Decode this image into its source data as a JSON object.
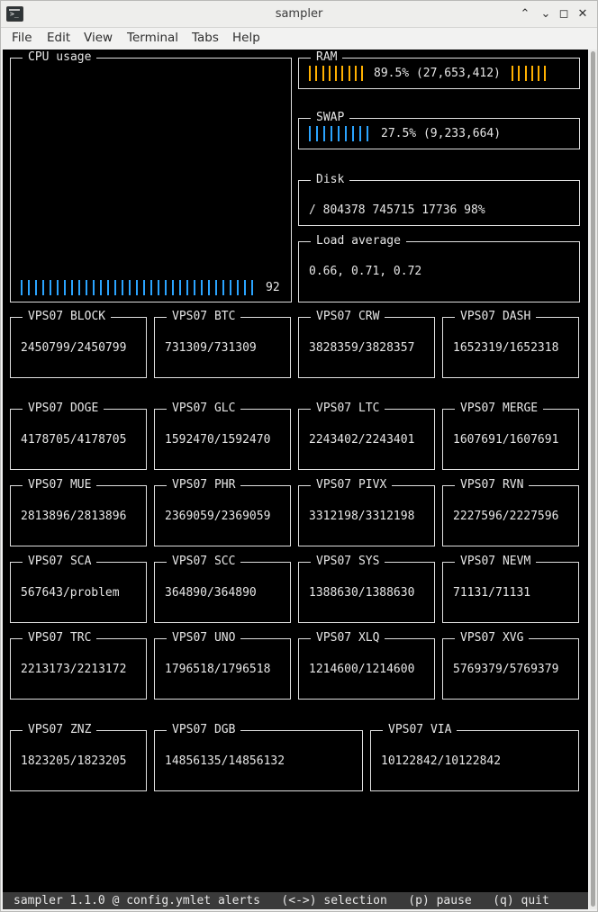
{
  "window": {
    "title": "sampler",
    "icon": "terminal-icon",
    "controls": {
      "minimize": "⌃",
      "restore": "⌄",
      "maximize": "◻",
      "close": "✕"
    }
  },
  "menubar": [
    "File",
    "Edit",
    "View",
    "Terminal",
    "Tabs",
    "Help"
  ],
  "cpu": {
    "title": "CPU usage",
    "value": "92",
    "level_percent": 92,
    "color": "#2aa4ff"
  },
  "ram": {
    "title": "RAM",
    "text": "89.5% (27,653,412)",
    "percent": 89.5,
    "color": "#ffb000"
  },
  "swap": {
    "title": "SWAP",
    "text": "27.5% (9,233,664)",
    "percent": 27.5,
    "color": "#2aa4ff"
  },
  "disk": {
    "title": "Disk",
    "text": "/ 804378 745715 17736 98%"
  },
  "load": {
    "title": "Load average",
    "text": "0.66, 0.71, 0.72"
  },
  "nodes": [
    {
      "title": "VPS07 BLOCK",
      "value": "2450799/2450799"
    },
    {
      "title": "VPS07 BTC",
      "value": "731309/731309"
    },
    {
      "title": "VPS07 CRW",
      "value": "3828359/3828357"
    },
    {
      "title": "VPS07 DASH",
      "value": "1652319/1652318"
    },
    {
      "title": "VPS07 DOGE",
      "value": "4178705/4178705"
    },
    {
      "title": "VPS07 GLC",
      "value": "1592470/1592470"
    },
    {
      "title": "VPS07 LTC",
      "value": "2243402/2243401"
    },
    {
      "title": "VPS07 MERGE",
      "value": "1607691/1607691"
    },
    {
      "title": "VPS07 MUE",
      "value": "2813896/2813896"
    },
    {
      "title": "VPS07 PHR",
      "value": "2369059/2369059"
    },
    {
      "title": "VPS07 PIVX",
      "value": "3312198/3312198"
    },
    {
      "title": "VPS07 RVN",
      "value": "2227596/2227596"
    },
    {
      "title": "VPS07 SCA",
      "value": "567643/problem"
    },
    {
      "title": "VPS07 SCC",
      "value": "364890/364890"
    },
    {
      "title": "VPS07 SYS",
      "value": "1388630/1388630"
    },
    {
      "title": "VPS07 NEVM",
      "value": "71131/71131"
    },
    {
      "title": "VPS07 TRC",
      "value": "2213173/2213172"
    },
    {
      "title": "VPS07 UNO",
      "value": "1796518/1796518"
    },
    {
      "title": "VPS07 XLQ",
      "value": "1214600/1214600"
    },
    {
      "title": "VPS07 XVG",
      "value": "5769379/5769379"
    },
    {
      "title": "VPS07 ZNZ",
      "value": "1823205/1823205"
    },
    {
      "title": "VPS07 DGB",
      "value": "14856135/14856132"
    },
    {
      "title": "VPS07 VIA",
      "value": "10122842/10122842"
    }
  ],
  "statusbar": "sampler 1.1.0 @ config.ymlet alerts   (<->) selection   (p) pause   (q) quit"
}
